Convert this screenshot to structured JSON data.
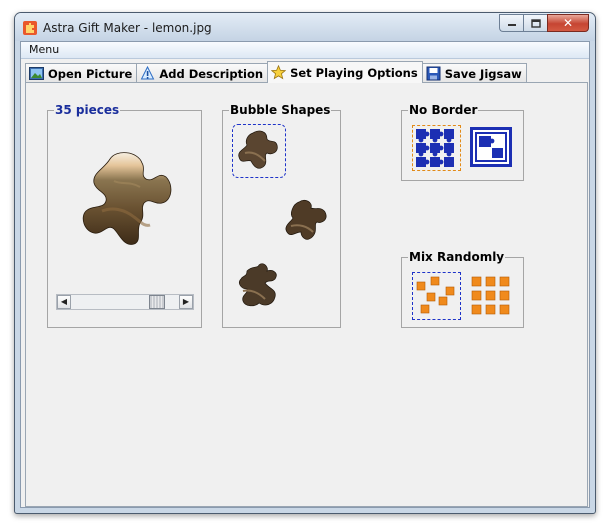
{
  "window": {
    "title": "Astra Gift Maker - lemon.jpg",
    "close_glyph": "✕"
  },
  "menu": {
    "label": "Menu"
  },
  "tabs": [
    {
      "label": "Open Picture",
      "icon": "picture-icon"
    },
    {
      "label": "Add Description",
      "icon": "info-icon"
    },
    {
      "label": "Set Playing Options",
      "icon": "star-icon",
      "active": true
    },
    {
      "label": "Save Jigsaw",
      "icon": "save-icon"
    }
  ],
  "pieces_group": {
    "title": "35 pieces",
    "slider_value_fraction": 0.85
  },
  "bubble_group": {
    "title": "Bubble Shapes"
  },
  "border_group": {
    "title": "No Border"
  },
  "mix_group": {
    "title": "Mix Randomly"
  },
  "colors": {
    "accent_blue": "#1a2e9c",
    "orange": "#f08a1c",
    "close_red": "#c64532"
  }
}
